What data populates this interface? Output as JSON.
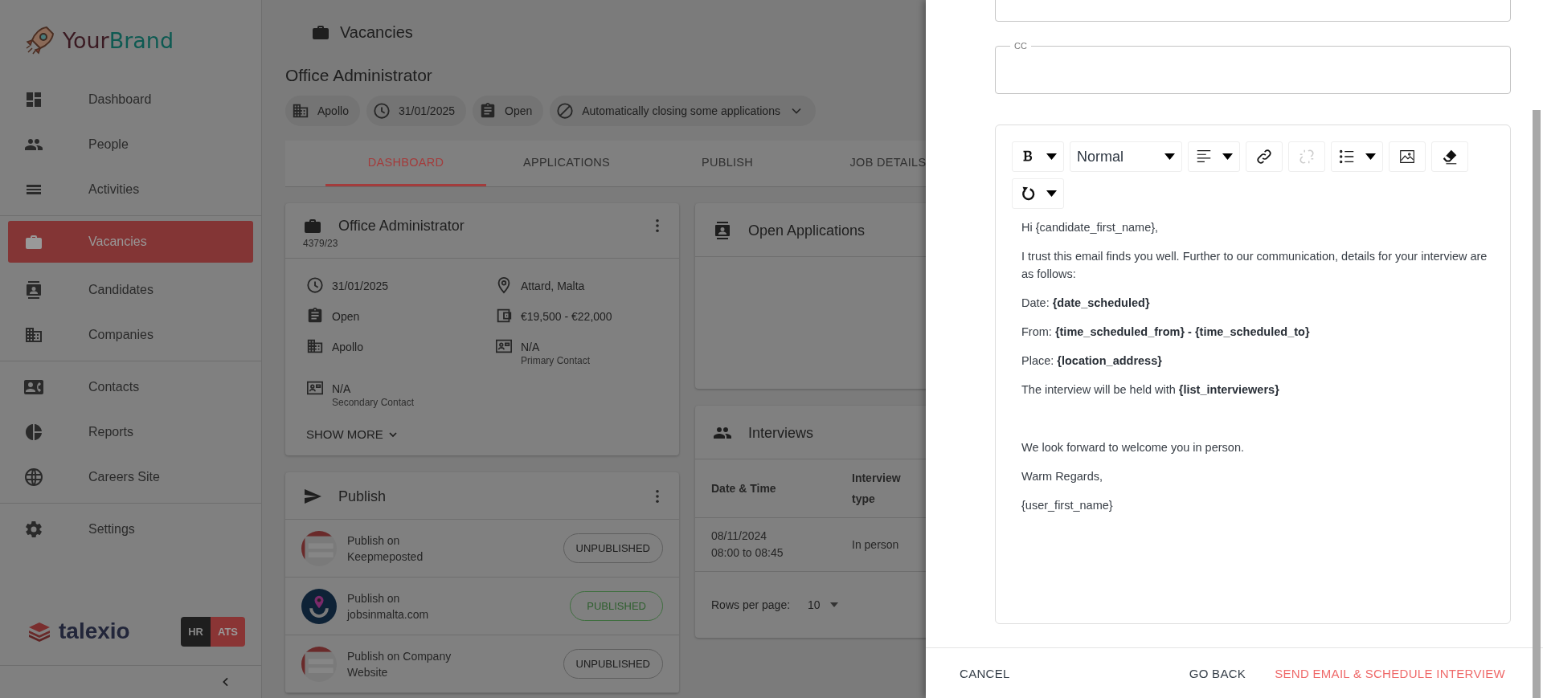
{
  "sidebar": {
    "brand": {
      "first": "Your",
      "second": "Brand"
    },
    "sections": [
      [
        {
          "label": "Dashboard",
          "selected": false
        },
        {
          "label": "People",
          "selected": false
        },
        {
          "label": "Activities",
          "selected": false
        }
      ],
      [
        {
          "label": "Vacancies",
          "selected": true
        },
        {
          "label": "Candidates",
          "selected": false
        },
        {
          "label": "Companies",
          "selected": false
        }
      ],
      [
        {
          "label": "Contacts",
          "selected": false
        },
        {
          "label": "Reports",
          "selected": false
        },
        {
          "label": "Careers Site",
          "selected": false
        }
      ],
      [
        {
          "label": "Settings",
          "selected": false
        }
      ]
    ],
    "footer_logo": "talexio",
    "modules": [
      {
        "label": "HR",
        "selected": false
      },
      {
        "label": "ATS",
        "selected": true
      }
    ]
  },
  "page": {
    "section_title": "Vacancies",
    "title": "Office Administrator",
    "chips": [
      {
        "label": "Apollo",
        "dropdown": false
      },
      {
        "label": "31/01/2025",
        "dropdown": false
      },
      {
        "label": "Open",
        "dropdown": false
      },
      {
        "label": "Automatically closing some applications",
        "dropdown": true
      }
    ],
    "tabs": [
      {
        "label": "DASHBOARD",
        "selected": true
      },
      {
        "label": "APPLICATIONS",
        "selected": false
      },
      {
        "label": "PUBLISH",
        "selected": false
      },
      {
        "label": "JOB DETAILS",
        "selected": false
      }
    ]
  },
  "vacancy_card": {
    "title": "Office Administrator",
    "reference": "4379/23",
    "details": [
      {
        "value": "31/01/2025"
      },
      {
        "value": "Attard, Malta"
      },
      {
        "value": "Open"
      },
      {
        "value": "€19,500 - €22,000"
      },
      {
        "value": "Apollo"
      },
      {
        "value": "N/A",
        "caption": "Primary Contact"
      },
      {
        "value": "N/A",
        "caption": "Secondary Contact"
      }
    ],
    "show_more": "SHOW MORE"
  },
  "publish_card": {
    "title": "Publish",
    "rows": [
      {
        "label": "Publish on Keepmeposted",
        "status": "UNPUBLISHED",
        "published": false
      },
      {
        "label": "Publish on jobsinmalta.com",
        "status": "PUBLISHED",
        "published": true
      },
      {
        "label": "Publish on Company Website",
        "status": "UNPUBLISHED",
        "published": false
      }
    ]
  },
  "applications_card": {
    "title": "Open Applications"
  },
  "interviews_card": {
    "title": "Interviews",
    "columns": [
      "Date & Time",
      "Interview type"
    ],
    "rows": [
      {
        "date": "08/11/2024",
        "time": "08:00 to 08:45",
        "type": "In person"
      }
    ],
    "rows_per_page_label": "Rows per page:",
    "rows_per_page": "10"
  },
  "email_panel": {
    "cc_label": "CC",
    "toolbar": [
      {
        "kind": "dropdown",
        "disabled": false
      },
      {
        "kind": "select",
        "value": "Normal",
        "disabled": false
      },
      {
        "kind": "dropdown",
        "disabled": false
      },
      {
        "kind": "button",
        "disabled": false
      },
      {
        "kind": "button",
        "disabled": true
      },
      {
        "kind": "dropdown",
        "disabled": false
      },
      {
        "kind": "button",
        "disabled": false
      },
      {
        "kind": "button",
        "disabled": false
      },
      {
        "kind": "dropdown",
        "disabled": false
      }
    ],
    "body": [
      "Hi {candidate_first_name},",
      "I trust this email finds you well. Further to our communication, details for your interview are as follows:",
      "Date: **{date_scheduled}**",
      "From:   **{time_scheduled_from} - {time_scheduled_to}**",
      "Place: **{location_address}**",
      "The interview will be held with **{list_interviewers}**"
    ],
    "closing": [
      "We look forward to welcome you in person.",
      "Warm Regards,",
      "{user_first_name}"
    ],
    "actions": [
      {
        "label": "CANCEL",
        "kind": "secondary"
      },
      {
        "label": "GO BACK",
        "kind": "secondary"
      },
      {
        "label": "SEND EMAIL & SCHEDULE INTERVIEW",
        "kind": "primary"
      }
    ]
  }
}
